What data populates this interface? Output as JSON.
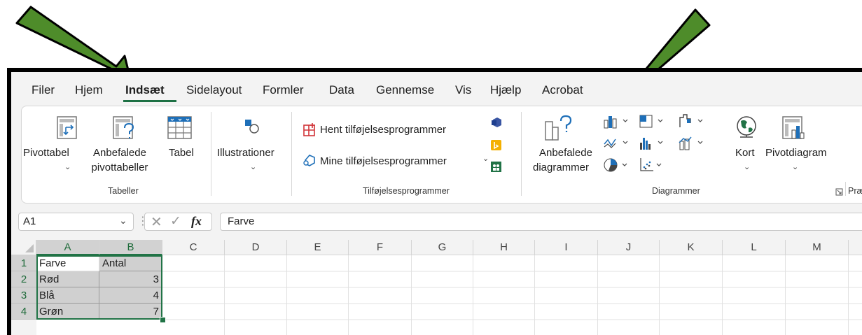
{
  "tabs": [
    "Filer",
    "Hjem",
    "Indsæt",
    "Sidelayout",
    "Formler",
    "Data",
    "Gennemse",
    "Vis",
    "Hjælp",
    "Acrobat"
  ],
  "active_tab": "Indsæt",
  "ribbon": {
    "tables": {
      "pivot": "Pivottabel",
      "recommended_line1": "Anbefalede",
      "recommended_line2": "pivottabeller",
      "table": "Tabel",
      "group_label": "Tabeller"
    },
    "illustrations": {
      "label": "Illustrationer"
    },
    "addins": {
      "get": "Hent tilføjelsesprogrammer",
      "mine": "Mine tilføjelsesprogrammer",
      "group_label": "Tilføjelsesprogrammer"
    },
    "charts": {
      "recommended_line1": "Anbefalede",
      "recommended_line2": "diagrammer",
      "maps": "Kort",
      "pivotchart": "Pivotdiagram",
      "group_label": "Diagrammer",
      "next_group_partial": "Præ"
    }
  },
  "formula_bar": {
    "name_box": "A1",
    "fx": "fx",
    "content": "Farve"
  },
  "columns": [
    "A",
    "B",
    "C",
    "D",
    "E",
    "F",
    "G",
    "H",
    "I",
    "J",
    "K",
    "L",
    "M"
  ],
  "rows": [
    "1",
    "2",
    "3",
    "4"
  ],
  "cells": [
    [
      "Farve",
      "Antal"
    ],
    [
      "Rød",
      "3"
    ],
    [
      "Blå",
      "4"
    ],
    [
      "Grøn",
      "7"
    ]
  ],
  "colors": {
    "accent_green": "#217346",
    "arrow_green": "#4e8c2a",
    "arrow_outline": "#000000"
  },
  "icons": [
    "pivot-table-icon",
    "recommended-pivot-icon",
    "table-icon",
    "shapes-icon",
    "store-icon",
    "my-addins-icon",
    "visio-icon",
    "bing-icon",
    "people-graph-icon",
    "recommended-charts-icon",
    "column-chart-icon",
    "hierarchy-chart-icon",
    "waterfall-chart-icon",
    "line-chart-icon",
    "statistic-chart-icon",
    "combo-chart-icon",
    "pie-chart-icon",
    "scatter-chart-icon",
    "globe-icon",
    "pivotchart-icon",
    "dialog-launcher-icon"
  ]
}
